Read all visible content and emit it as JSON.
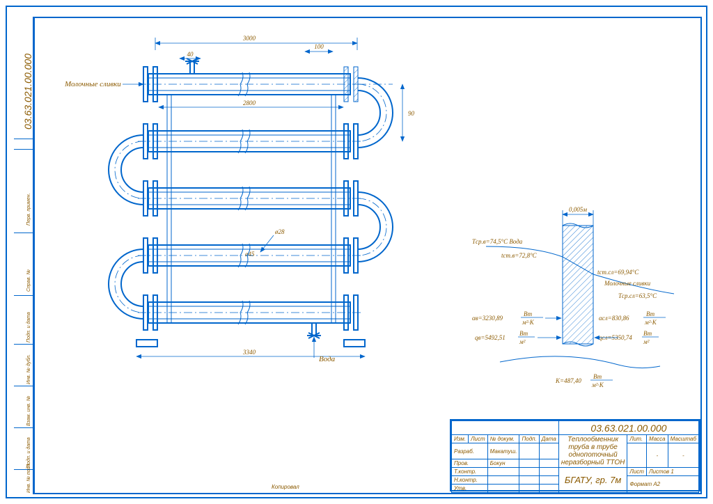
{
  "drawing_number": "03.63.021.00.000",
  "labels": {
    "cream_inlet": "Молочные сливки",
    "water_inlet": "Вода",
    "copy": "Копировал"
  },
  "dimensions": {
    "overall_len_top": "3000",
    "flange_gap": "100",
    "nozzle": "40",
    "inner_pipe_len": "2800",
    "spacing": "90",
    "base_len": "3340",
    "wall_thk": "0,005м",
    "inner_dia": "ø28",
    "outer_dia": "ø45"
  },
  "thermal": {
    "t_sr_v": "Tср.в=74,5°C",
    "water_word": "Вода",
    "t_st_v": "tст.в=72,8°C",
    "t_st_sl": "tст.сл=69,94°C",
    "cream_word": "Молочные сливки",
    "t_sr_sl": "Tср.сл=63,5°C",
    "alpha_v": "αв=3230,89",
    "alpha_v_unit": "Вт/м²·K",
    "alpha_sl": "αсл=830,86",
    "alpha_sl_unit": "Вт/м²·K",
    "q_v": "qв=5492,51",
    "q_v_unit": "Вт/м²",
    "q_sl": "qсл=5350,74",
    "q_sl_unit": "Вт/м²",
    "k_coef": "K=487,40",
    "k_unit": "Вт/м²·K"
  },
  "title_block": {
    "number": "03.63.021.00.000",
    "name1": "Теплообменник труба в трубе",
    "name2": "однопоточный неразборный ТТОН",
    "org": "БГАТУ, гр. 7м",
    "lit": "Лит.",
    "mass": "Масса",
    "scale": "Масштаб",
    "sheet": "Лист",
    "sheets": "Листов  1",
    "format": "Формат   A2",
    "roles": {
      "izm": "Изм.",
      "list": "Лист",
      "doc": "№ докум.",
      "sign": "Подп.",
      "date": "Дата",
      "razrab": "Разраб.",
      "razrab_n": "Макатуш.",
      "prov": "Пров.",
      "prov_n": "Бокун",
      "tkontr": "Т.контр.",
      "nkontr": "Н.контр.",
      "utv": "Утв."
    }
  },
  "left_margin": {
    "t1": "Перв. примен.",
    "t2": "Справ. №",
    "t3": "Подп. и дата",
    "t4": "Инв. № дубл.",
    "t5": "Взам. инв. №",
    "t6": "Подп. и дата",
    "t7": "Инв. № подл."
  }
}
